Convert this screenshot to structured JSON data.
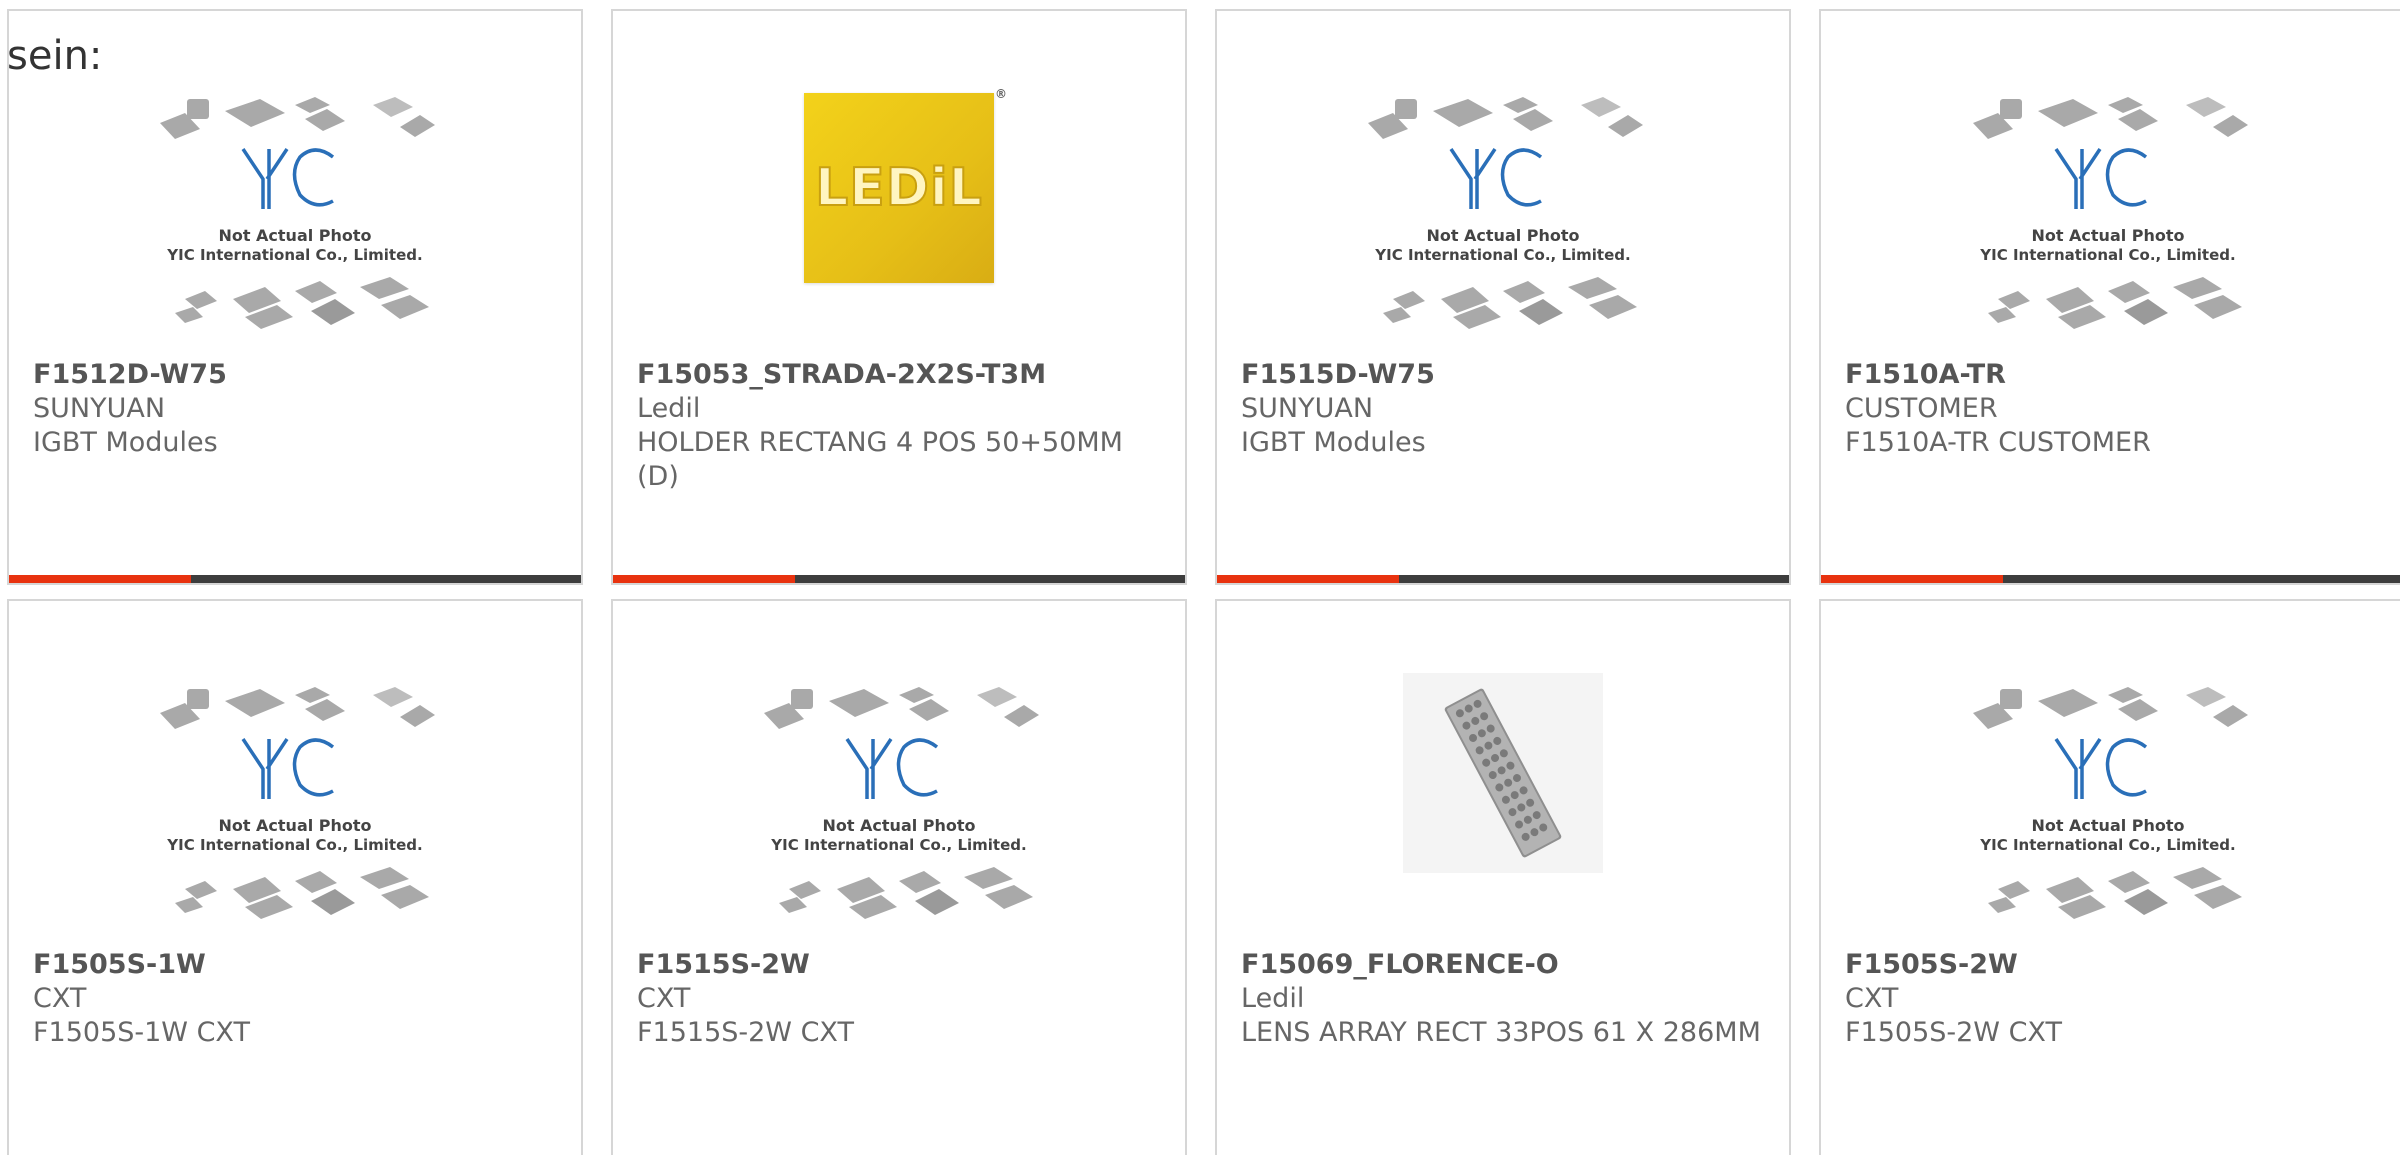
{
  "page": {
    "heading": "sein:"
  },
  "placeholder": {
    "line1": "Not Actual Photo",
    "line2": "YIC International Co., Limited.",
    "logo": "YIC"
  },
  "brand_logo": {
    "text": "LEDiL",
    "reg": "®"
  },
  "products": [
    {
      "part_number": "F1512D-W75",
      "manufacturer": "SUNYUAN",
      "description": "IGBT Modules",
      "image": "yic-placeholder"
    },
    {
      "part_number": "F15053_STRADA-2X2S-T3M",
      "manufacturer": "Ledil",
      "description": "HOLDER RECTANG 4 POS 50+50MM (D)",
      "image": "ledil-logo"
    },
    {
      "part_number": "F1515D-W75",
      "manufacturer": "SUNYUAN",
      "description": "IGBT Modules",
      "image": "yic-placeholder"
    },
    {
      "part_number": "F1510A-TR",
      "manufacturer": "CUSTOMER",
      "description": "F1510A-TR CUSTOMER",
      "image": "yic-placeholder"
    },
    {
      "part_number": "F1505S-1W",
      "manufacturer": "CXT",
      "description": "F1505S-1W CXT",
      "image": "yic-placeholder"
    },
    {
      "part_number": "F1515S-2W",
      "manufacturer": "CXT",
      "description": "F1515S-2W CXT",
      "image": "yic-placeholder"
    },
    {
      "part_number": "F15069_FLORENCE-O",
      "manufacturer": "Ledil",
      "description": "LENS ARRAY RECT 33POS 61 X 286MM",
      "image": "lens-array-photo"
    },
    {
      "part_number": "F1505S-2W",
      "manufacturer": "CXT",
      "description": "F1505S-2W CXT",
      "image": "yic-placeholder"
    }
  ],
  "colors": {
    "accent": "#e8320f",
    "bar": "#3d3d3d",
    "border": "#d6d6d6",
    "yic_blue": "#2a6fb8"
  }
}
